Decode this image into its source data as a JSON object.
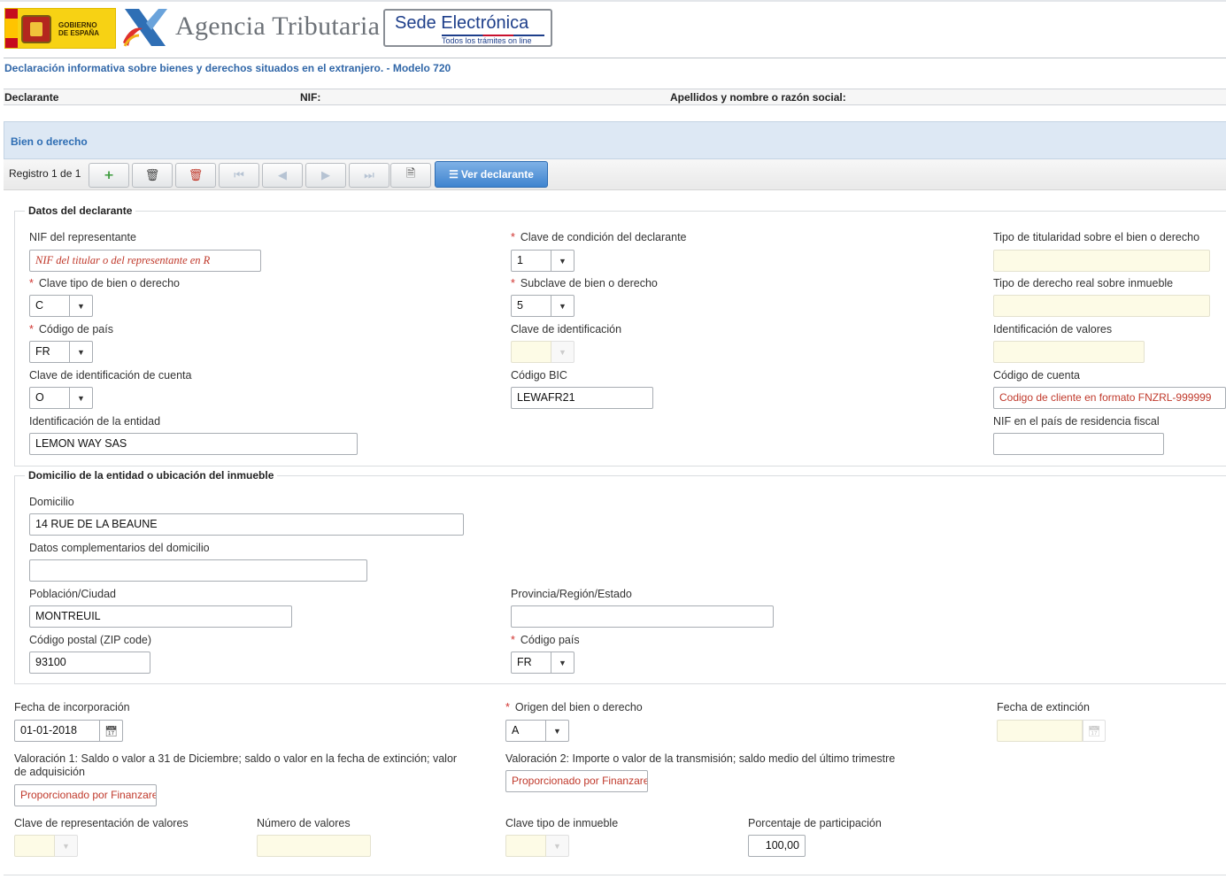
{
  "header": {
    "gobierno_line1": "GOBIERNO",
    "gobierno_line2": "DE ESPAÑA",
    "agencia": "Agencia Tributaria",
    "sede_title": "Sede Electrónica",
    "sede_sub": "Todos los trámites on line"
  },
  "page_title": "Declaración informativa sobre bienes y derechos situados en el extranjero. - Modelo 720",
  "declarante_bar": {
    "declarante": "Declarante",
    "nif": "NIF:",
    "apellidos": "Apellidos y nombre o razón social:"
  },
  "panel": {
    "title": "Bien o derecho"
  },
  "toolbar": {
    "registro": "Registro 1 de 1",
    "ver_declarante": "Ver declarante",
    "icons": [
      "add-record-icon",
      "delete-icon",
      "delete-all-icon",
      "first-icon",
      "previous-icon",
      "next-icon",
      "last-icon",
      "validate-icon"
    ]
  },
  "datos": {
    "legend": "Datos del declarante",
    "nif_rep_label": "NIF del representante",
    "nif_rep_value": "NIF del titular o del representante en R",
    "clave_cond_label": "Clave de condición del declarante",
    "clave_cond_value": "1",
    "tipo_tit_label": "Tipo de titularidad sobre el bien o derecho",
    "clave_tipo_label": "Clave tipo de bien o derecho",
    "clave_tipo_value": "C",
    "subclave_label": "Subclave de bien o derecho",
    "subclave_value": "5",
    "tipo_derecho_label": "Tipo de derecho real sobre inmueble",
    "cod_pais_label": "Código de país",
    "cod_pais_value": "FR",
    "clave_ident_label": "Clave de identificación",
    "ident_valores_label": "Identificación de valores",
    "clave_ident_cuenta_label": "Clave de identificación de cuenta",
    "clave_ident_cuenta_value": "O",
    "bic_label": "Código BIC",
    "bic_value": "LEWAFR21",
    "cod_cuenta_label": "Código de cuenta",
    "cod_cuenta_value": "Codigo de cliente en formato FNZRL-999999",
    "ident_entidad_label": "Identificación de la entidad",
    "ident_entidad_value": "LEMON WAY SAS",
    "nif_residencia_label": "NIF en el país de residencia fiscal",
    "nif_residencia_value": ""
  },
  "domicilio": {
    "legend": "Domicilio de la entidad o ubicación del inmueble",
    "domicilio_label": "Domicilio",
    "domicilio_value": "14 RUE DE LA BEAUNE",
    "complementarios_label": "Datos complementarios del domicilio",
    "complementarios_value": "",
    "poblacion_label": "Población/Ciudad",
    "poblacion_value": "MONTREUIL",
    "provincia_label": "Provincia/Región/Estado",
    "provincia_value": "",
    "cp_label": "Código postal (ZIP code)",
    "cp_value": "93100",
    "pais_label": "Código país",
    "pais_value": "FR"
  },
  "otros": {
    "fecha_inc_label": "Fecha de incorporación",
    "fecha_inc_value": "01-01-2018",
    "origen_label": "Origen del bien o derecho",
    "origen_value": "A",
    "fecha_ext_label": "Fecha de extinción",
    "val1_label_line1": "Valoración 1: Saldo o valor a 31 de Diciembre; saldo o valor en la fecha de extinción; valor",
    "val1_label_line2": "de adquisición",
    "val1_value": "Proporcionado por Finanzarel",
    "val2_label": "Valoración 2: Importe o valor de la transmisión; saldo medio del último trimestre",
    "val2_value": "Proporcionado por Finanzarel",
    "clave_rep_label": "Clave de representación de valores",
    "num_valores_label": "Número de valores",
    "clave_inmueble_label": "Clave tipo de inmueble",
    "porcentaje_label": "Porcentaje de participación",
    "porcentaje_value": "100,00"
  }
}
